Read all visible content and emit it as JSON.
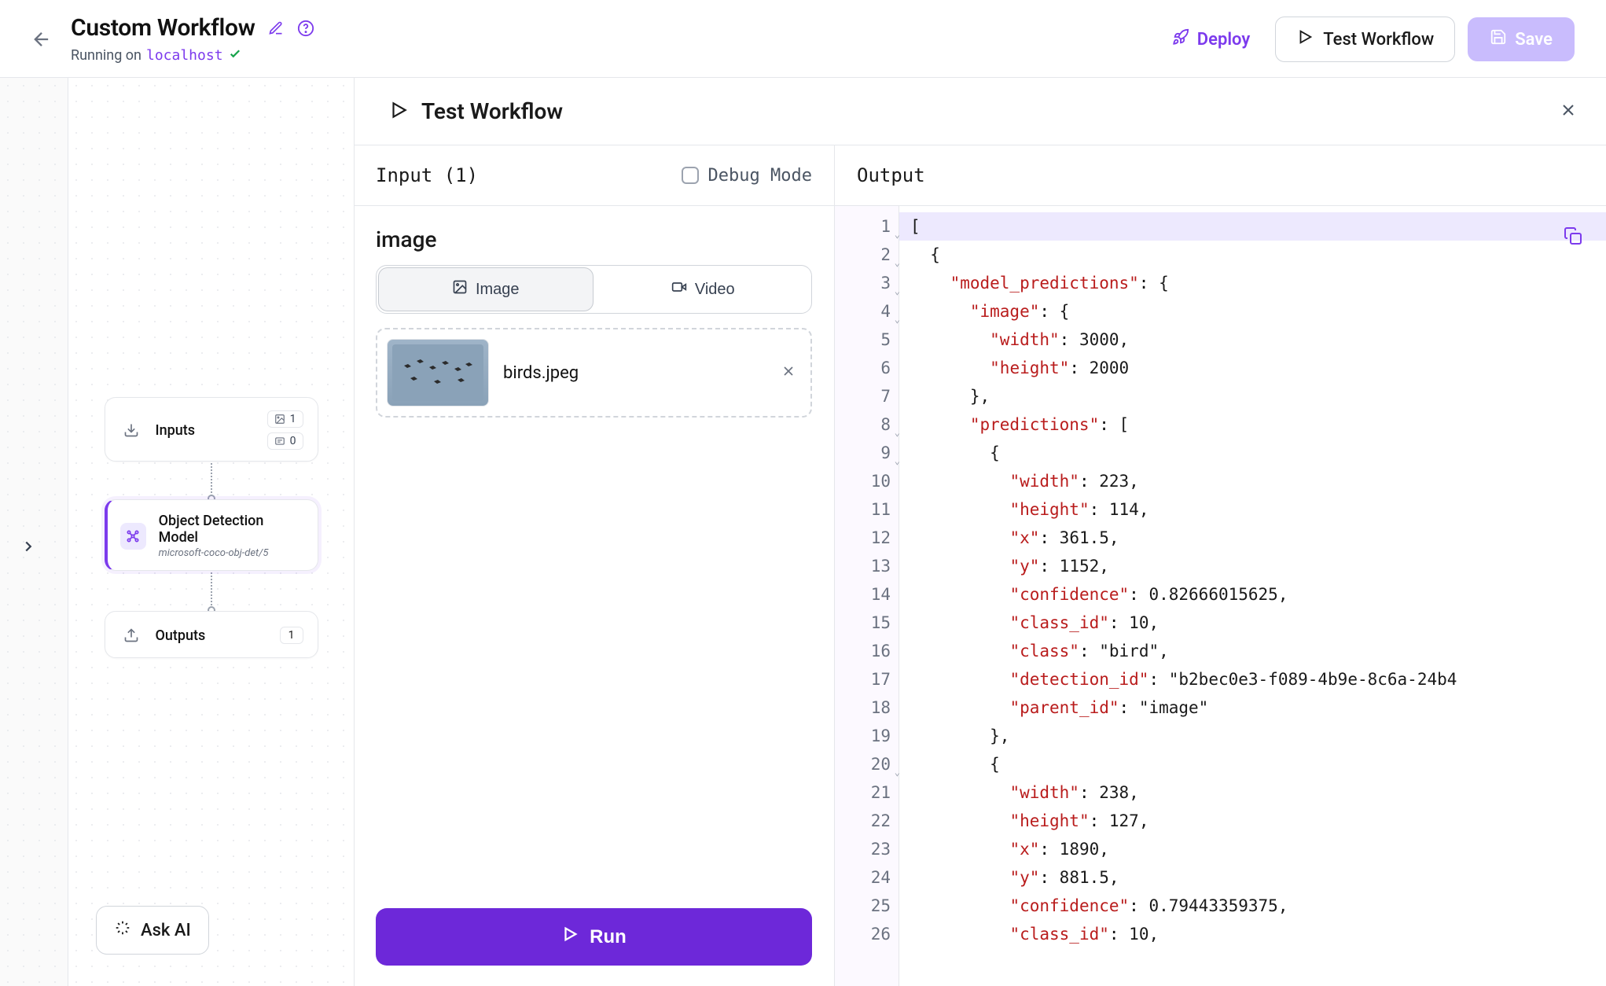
{
  "header": {
    "title": "Custom Workflow",
    "running_prefix": "Running on",
    "host": "localhost",
    "deploy": "Deploy",
    "test": "Test Workflow",
    "save": "Save"
  },
  "canvas": {
    "inputs": {
      "label": "Inputs",
      "image_count": "1",
      "text_count": "0"
    },
    "model": {
      "label": "Object Detection Model",
      "sub": "microsoft-coco-obj-det/5"
    },
    "outputs": {
      "label": "Outputs",
      "count": "1"
    },
    "askai": "Ask AI"
  },
  "test": {
    "title": "Test Workflow",
    "input_title": "Input (1)",
    "debug": "Debug Mode",
    "field": "image",
    "tab_image": "Image",
    "tab_video": "Video",
    "file": "birds.jpeg",
    "run": "Run",
    "output_title": "Output"
  },
  "code": {
    "foldable": [
      1,
      2,
      3,
      4,
      8,
      9,
      20
    ],
    "lines": [
      "[",
      "  {",
      "    \"model_predictions\": {",
      "      \"image\": {",
      "        \"width\": 3000,",
      "        \"height\": 2000",
      "      },",
      "      \"predictions\": [",
      "        {",
      "          \"width\": 223,",
      "          \"height\": 114,",
      "          \"x\": 361.5,",
      "          \"y\": 1152,",
      "          \"confidence\": 0.82666015625,",
      "          \"class_id\": 10,",
      "          \"class\": \"bird\",",
      "          \"detection_id\": \"b2bec0e3-f089-4b9e-8c6a-24b4",
      "          \"parent_id\": \"image\"",
      "        },",
      "        {",
      "          \"width\": 238,",
      "          \"height\": 127,",
      "          \"x\": 1890,",
      "          \"y\": 881.5,",
      "          \"confidence\": 0.79443359375,",
      "          \"class_id\": 10,"
    ]
  }
}
